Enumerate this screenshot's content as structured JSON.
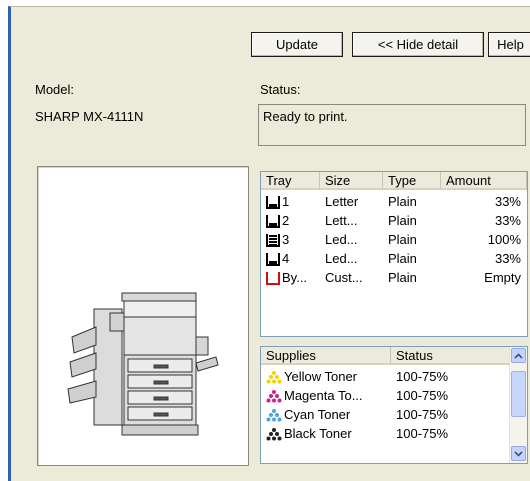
{
  "toolbar": {
    "update_label": "Update",
    "hide_detail_label": "<< Hide detail",
    "help_label": "Help"
  },
  "model": {
    "label": "Model:",
    "value": "SHARP MX-4111N"
  },
  "status": {
    "label": "Status:",
    "value": "Ready to print."
  },
  "tray_table": {
    "headers": [
      "Tray",
      "Size",
      "Type",
      "Amount"
    ],
    "rows": [
      {
        "tray": "1",
        "size": "Letter",
        "type": "Plain",
        "amount": "33%",
        "icon": "tray-partial-icon"
      },
      {
        "tray": "2",
        "size": "Lett...",
        "type": "Plain",
        "amount": "33%",
        "icon": "tray-partial-icon"
      },
      {
        "tray": "3",
        "size": "Led...",
        "type": "Plain",
        "amount": "100%",
        "icon": "tray-full-icon"
      },
      {
        "tray": "4",
        "size": "Led...",
        "type": "Plain",
        "amount": "33%",
        "icon": "tray-partial-icon"
      },
      {
        "tray": "By...",
        "size": "Cust...",
        "type": "Plain",
        "amount": "Empty",
        "icon": "bypass-tray-empty-icon"
      }
    ]
  },
  "supplies_table": {
    "headers": [
      "Supplies",
      "Status"
    ],
    "rows": [
      {
        "name": "Yellow Toner",
        "status": "100-75%",
        "icon": "toner-dots-icon",
        "color": "#f2d200"
      },
      {
        "name": "Magenta To...",
        "status": "100-75%",
        "icon": "toner-dots-icon",
        "color": "#d0208f"
      },
      {
        "name": "Cyan Toner",
        "status": "100-75%",
        "icon": "toner-dots-icon",
        "color": "#4aa6e0"
      },
      {
        "name": "Black Toner",
        "status": "100-75%",
        "icon": "toner-dots-icon",
        "color": "#222222"
      }
    ]
  },
  "colors": {
    "window_bg": "#ecead8",
    "accent_border": "#2f5fb3",
    "empty_tray": "#d01010"
  }
}
